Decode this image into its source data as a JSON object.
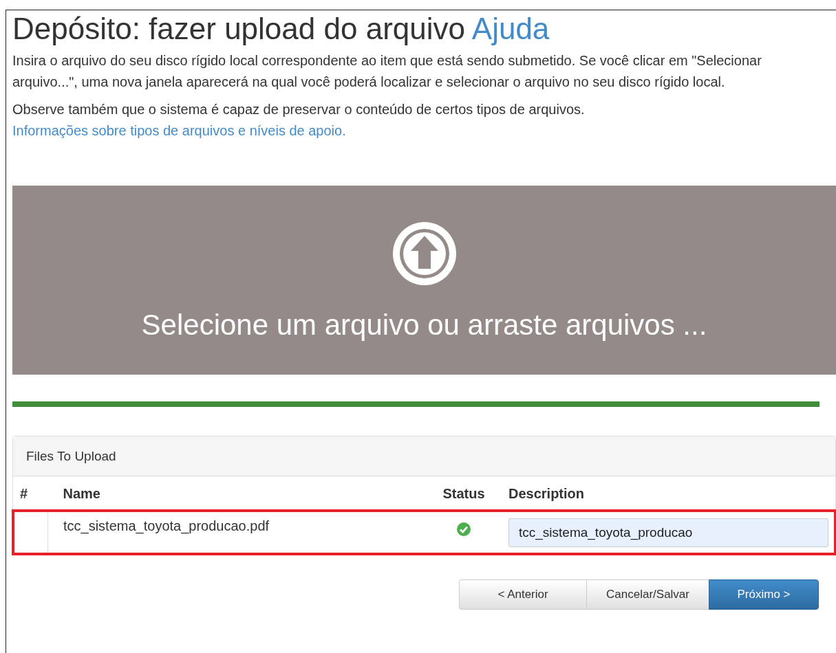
{
  "heading": {
    "title": "Depósito: fazer upload do arquivo",
    "help_link": "Ajuda"
  },
  "intro": "Insira o arquivo do seu disco rígido local correspondente ao item que está sendo submetido. Se você clicar em \"Selecionar arquivo...\", uma nova janela aparecerá na qual você poderá localizar e selecionar o arquivo no seu disco rígido local.",
  "note": {
    "text": "Observe também que o sistema é capaz de preservar o conteúdo de certos tipos de arquivos.",
    "link": "Informações sobre tipos de arquivos e níveis de apoio."
  },
  "dropzone": {
    "label": "Selecione um arquivo ou arraste arquivos ..."
  },
  "progress": {
    "level": 1
  },
  "files_panel": {
    "title": "Files To Upload",
    "columns": [
      "#",
      "Name",
      "Status",
      "Description"
    ],
    "rows": [
      {
        "name": "tcc_sistema_toyota_producao.pdf",
        "status_ok": true,
        "description": "tcc_sistema_toyota_producao",
        "highlighted": true
      }
    ]
  },
  "buttons": [
    {
      "label": "< Anterior",
      "kind": "default"
    },
    {
      "label": "Cancelar/Salvar",
      "kind": "default"
    },
    {
      "label": "Próximo >",
      "kind": "primary"
    }
  ]
}
